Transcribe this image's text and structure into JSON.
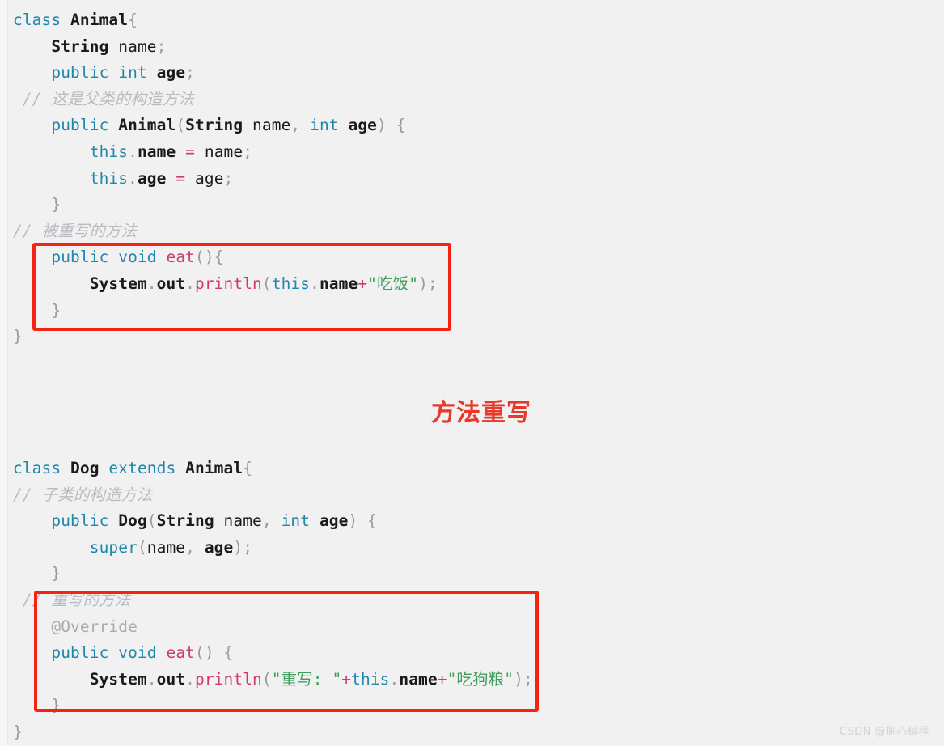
{
  "document": {
    "kind": "java-source-illustration",
    "background_color": "#f1f1f1",
    "caption": "方法重写",
    "caption_color": "#e8392b",
    "watermark": "CSDN @偷心编程"
  },
  "highlights": [
    {
      "name": "parent-eat-method",
      "label": "被重写的方法",
      "border_color": "#f42314"
    },
    {
      "name": "child-eat-method",
      "label": "重写的方法",
      "border_color": "#f42314"
    }
  ],
  "code": {
    "parent_class": [
      {
        "id": "p1",
        "text": "class Animal{"
      },
      {
        "id": "p2",
        "text": "    String name;"
      },
      {
        "id": "p3",
        "text": "    public int age;"
      },
      {
        "id": "p4",
        "text": " // 这是父类的构造方法"
      },
      {
        "id": "p5",
        "text": "    public Animal(String name, int age) {"
      },
      {
        "id": "p6",
        "text": "        this.name = name;"
      },
      {
        "id": "p7",
        "text": "        this.age = age;"
      },
      {
        "id": "p8",
        "text": "    }"
      },
      {
        "id": "p9",
        "text": "// 被重写的方法"
      },
      {
        "id": "p10",
        "text": "    public void eat(){"
      },
      {
        "id": "p11",
        "text": "        System.out.println(this.name+\"吃饭\");"
      },
      {
        "id": "p12",
        "text": "    }"
      },
      {
        "id": "p13",
        "text": "}"
      }
    ],
    "child_class": [
      {
        "id": "c1",
        "text": "class Dog extends Animal{"
      },
      {
        "id": "c2",
        "text": "// 子类的构造方法"
      },
      {
        "id": "c3",
        "text": "    public Dog(String name, int age) {"
      },
      {
        "id": "c4",
        "text": "        super(name, age);"
      },
      {
        "id": "c5",
        "text": "    }"
      },
      {
        "id": "c6",
        "text": " // 重写的方法"
      },
      {
        "id": "c7",
        "text": "    @Override"
      },
      {
        "id": "c8",
        "text": "    public void eat() {"
      },
      {
        "id": "c9",
        "text": "        System.out.println(\"重写: \"+this.name+\"吃狗粮\");"
      },
      {
        "id": "c10",
        "text": "    }"
      },
      {
        "id": "c11",
        "text": "}"
      }
    ]
  },
  "colors": {
    "keyword": "#1e87ab",
    "identifier": "#1a1a1a",
    "method": "#d1386c",
    "string": "#3f9e5a",
    "comment": "#b8bcc0",
    "punctuation": "#9a9a9a",
    "annotation": "#a9acb0"
  }
}
